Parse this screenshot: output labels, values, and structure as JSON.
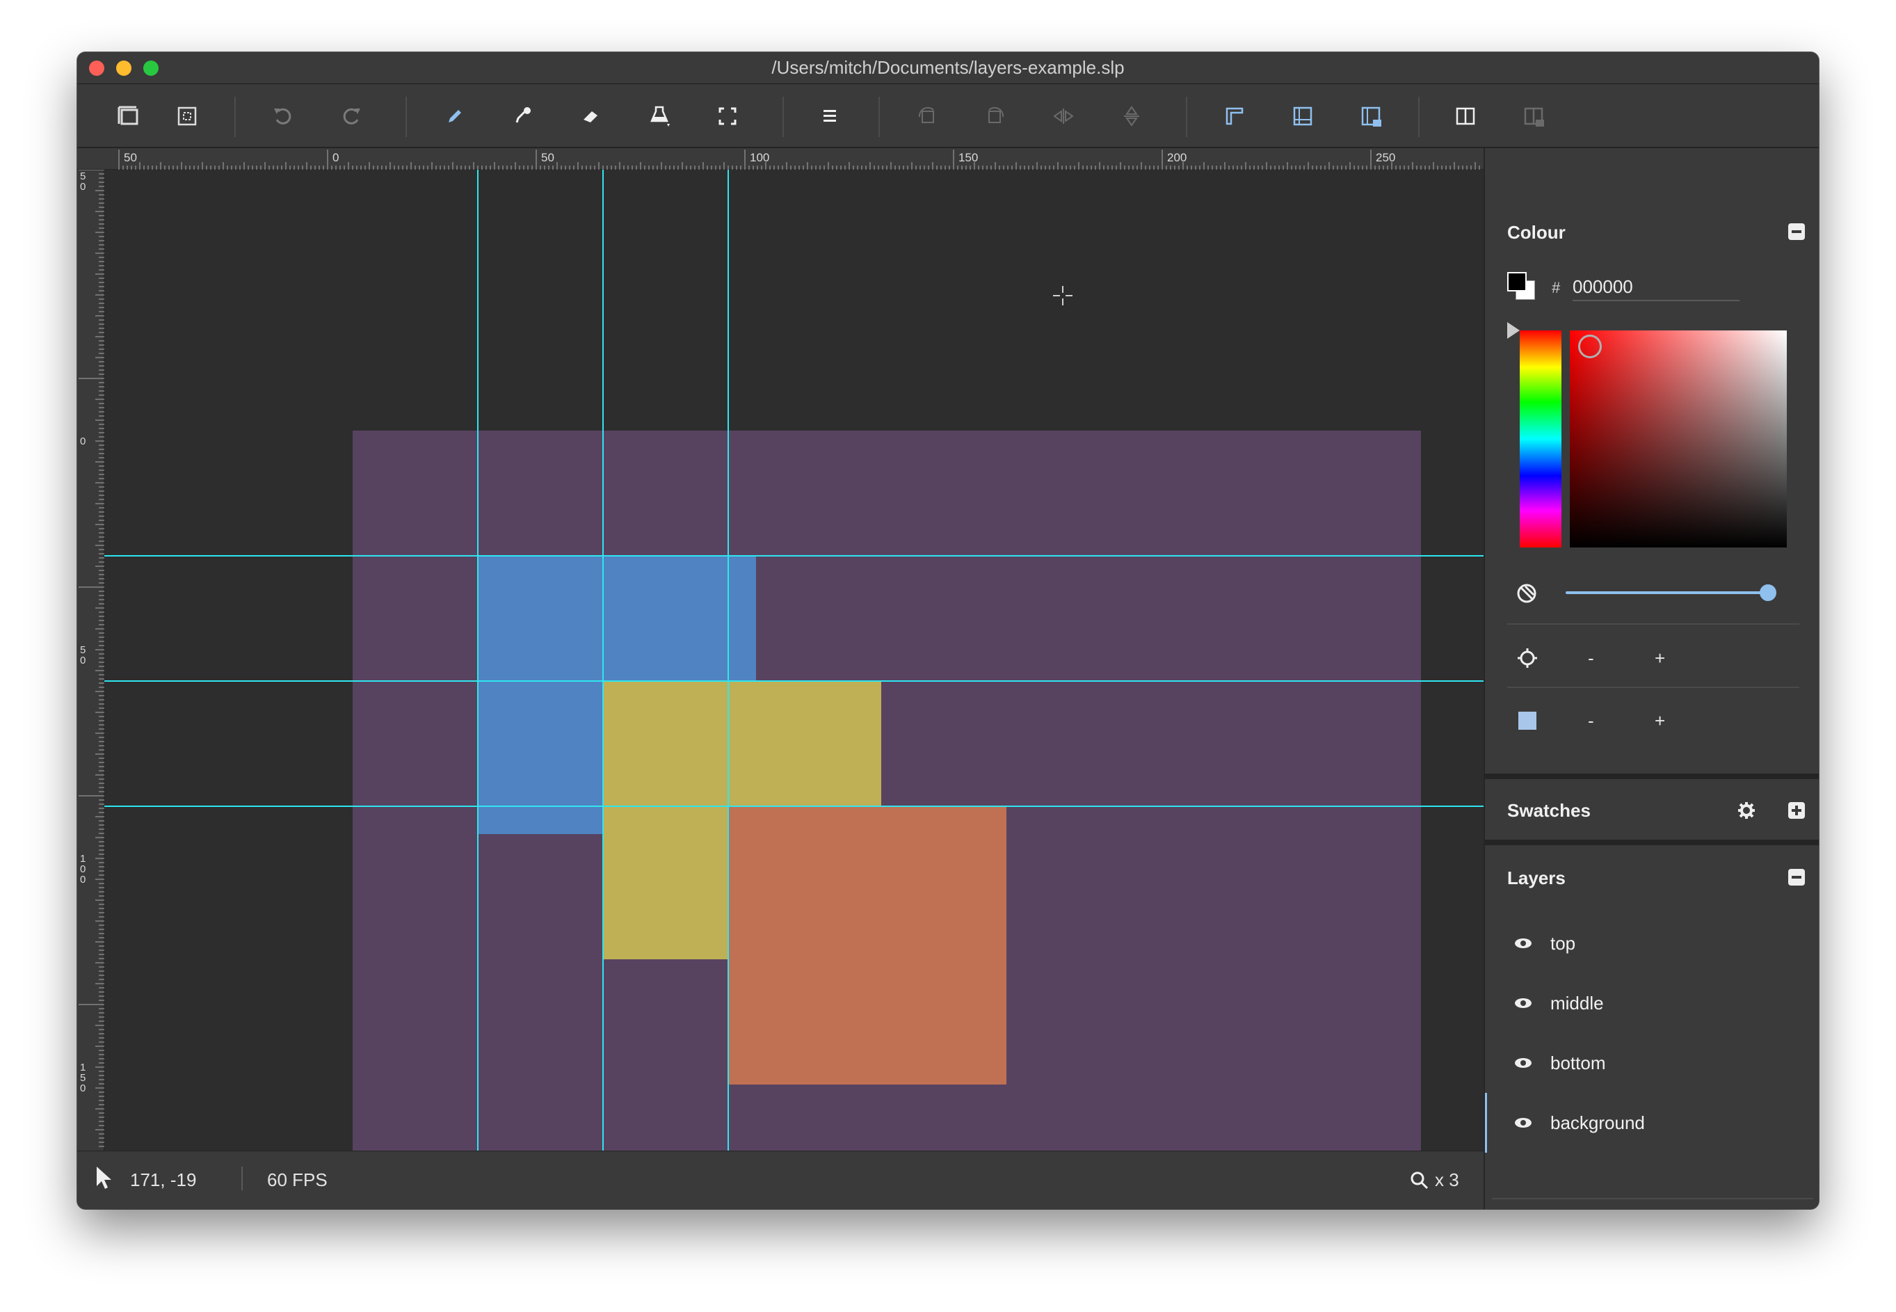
{
  "window": {
    "title": "/Users/mitch/Documents/layers-example.slp"
  },
  "toolbar": {
    "icons": [
      "new-canvas-icon",
      "resize-canvas-icon",
      "undo-icon",
      "redo-icon",
      "pencil-icon",
      "eyedropper-icon",
      "eraser-icon",
      "fill-icon",
      "selection-icon",
      "menu-icon",
      "rotate-left-icon",
      "rotate-right-icon",
      "flip-horizontal-icon",
      "flip-vertical-icon",
      "ruler-guides-icon",
      "grid-icon",
      "lock-guides-icon",
      "split-view-icon",
      "lock-split-icon"
    ]
  },
  "ruler": {
    "top_labels": [
      "50",
      "0",
      "50",
      "100",
      "150",
      "200",
      "250"
    ],
    "left_labels": [
      "50",
      "0",
      "50",
      "100",
      "150"
    ]
  },
  "canvas": {
    "layers_colors": {
      "background": "#574360",
      "bottom": "#5083c1",
      "middle": "#bfaf55",
      "top": "#c07153"
    },
    "guide_color": "#2ee6f0"
  },
  "status": {
    "cursor_pos": "171, -19",
    "fps": "60 FPS",
    "zoom": "x 3"
  },
  "colour_panel": {
    "title": "Colour",
    "hash": "#",
    "hex": "000000",
    "minus": "-",
    "plus": "+"
  },
  "swatches_panel": {
    "title": "Swatches"
  },
  "layers_panel": {
    "title": "Layers",
    "layers": [
      {
        "name": "top"
      },
      {
        "name": "middle"
      },
      {
        "name": "bottom"
      },
      {
        "name": "background"
      }
    ],
    "add": "+"
  }
}
